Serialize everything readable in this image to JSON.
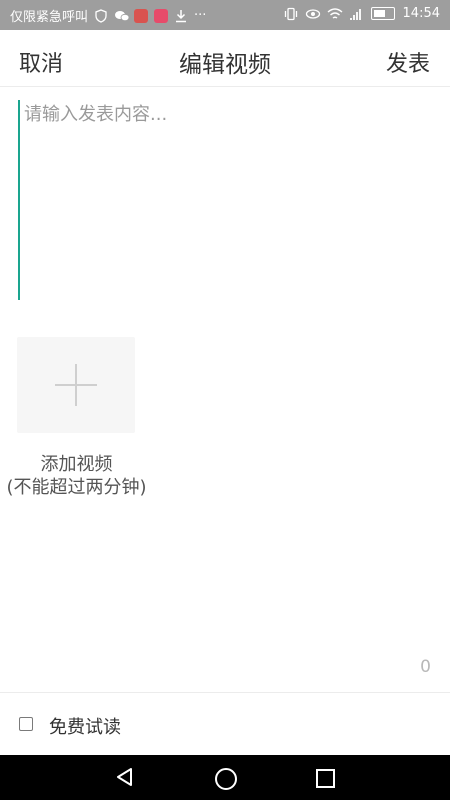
{
  "status_bar": {
    "carrier": "仅限紧急呼叫",
    "more": "···",
    "time": "14:54"
  },
  "header": {
    "cancel_label": "取消",
    "title": "编辑视频",
    "publish_label": "发表"
  },
  "content": {
    "placeholder": "请输入发表内容..."
  },
  "add_video": {
    "label": "添加视频",
    "hint": "(不能超过两分钟)"
  },
  "counter": "0",
  "options": {
    "free_trial_label": "免费试读",
    "free_trial_checked": false
  },
  "colors": {
    "cursor": "#1aa58f",
    "status_bar": "#9e9e9e"
  }
}
